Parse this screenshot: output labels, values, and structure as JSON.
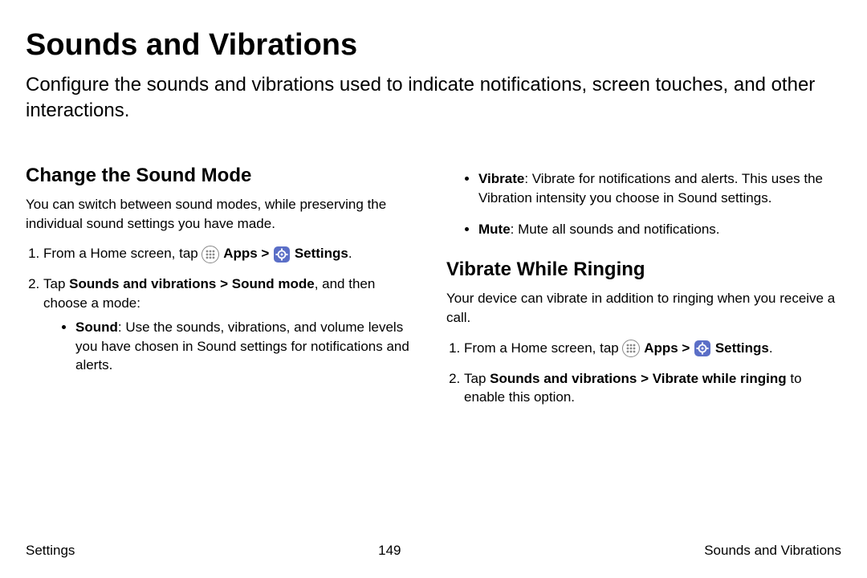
{
  "title": "Sounds and Vibrations",
  "intro": "Configure the sounds and vibrations used to indicate notifications, screen touches, and other interactions.",
  "section1": {
    "heading": "Change the Sound Mode",
    "intro": "You can switch between sound modes, while preserving the individual sound settings you have made.",
    "step1_pre": "From a Home screen, tap ",
    "step1_apps": "Apps",
    "step1_sep": " > ",
    "step1_settings": "Settings",
    "step1_end": ".",
    "step2_pre": "Tap ",
    "step2_bold": "Sounds and vibrations > Sound mode",
    "step2_post": ", and then choose a mode:",
    "mode1_label": "Sound",
    "mode1_text": ": Use the sounds, vibrations, and volume levels you have chosen in Sound settings for notifications and alerts.",
    "mode2_label": "Vibrate",
    "mode2_text": ": Vibrate for notifications and alerts. This uses the Vibration intensity you choose in Sound settings.",
    "mode3_label": "Mute",
    "mode3_text": ": Mute all sounds and notifications."
  },
  "section2": {
    "heading": "Vibrate While Ringing",
    "intro": "Your device can vibrate in addition to ringing when you receive a call.",
    "step1_pre": "From a Home screen, tap ",
    "step1_apps": "Apps",
    "step1_sep": " > ",
    "step1_settings": "Settings",
    "step1_end": ".",
    "step2_pre": "Tap ",
    "step2_bold": "Sounds and vibrations > Vibrate while ringing",
    "step2_post": " to enable this option."
  },
  "footer": {
    "left": "Settings",
    "center": "149",
    "right": "Sounds and Vibrations"
  }
}
